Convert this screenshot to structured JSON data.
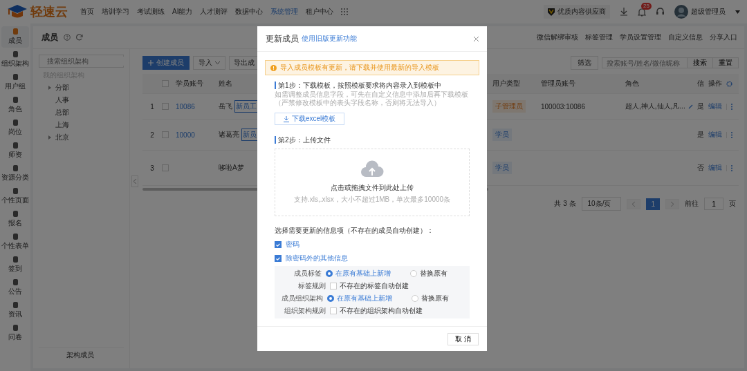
{
  "header": {
    "logo": "轻速云",
    "nav": [
      {
        "label": "首页",
        "selected": false
      },
      {
        "label": "培训学习",
        "selected": false
      },
      {
        "label": "考试测练",
        "selected": false
      },
      {
        "label": "AI能力",
        "selected": false
      },
      {
        "label": "人才测评",
        "selected": false
      },
      {
        "label": "数据中心",
        "selected": false
      },
      {
        "label": "系统管理",
        "selected": true
      },
      {
        "label": "租户中心",
        "selected": false
      }
    ],
    "badge": "优质内容供应商",
    "notifications": "25",
    "user": "超级管理员"
  },
  "sidebar": {
    "items": [
      {
        "label": "成员",
        "selected": true
      },
      {
        "label": "组织架构",
        "selected": false
      },
      {
        "label": "用户组",
        "selected": false
      },
      {
        "label": "角色",
        "selected": false
      },
      {
        "label": "岗位",
        "selected": false
      },
      {
        "label": "师资",
        "selected": false
      },
      {
        "label": "资源分类",
        "selected": false
      },
      {
        "label": "个性页面",
        "selected": false
      },
      {
        "label": "报名",
        "selected": false
      },
      {
        "label": "个性表单",
        "selected": false
      },
      {
        "label": "签到",
        "selected": false
      },
      {
        "label": "公告",
        "selected": false
      },
      {
        "label": "资讯",
        "selected": false
      },
      {
        "label": "问卷",
        "selected": false
      }
    ]
  },
  "page": {
    "title": "成员",
    "actions": [
      "微信解绑审核",
      "标签管理",
      "学员设置管理",
      "自定义信息",
      "分享入口"
    ]
  },
  "tree": {
    "search_placeholder": "搜索组织架构",
    "root": "我的组织架构",
    "items": [
      {
        "label": "分部",
        "expandable": true
      },
      {
        "label": "人事",
        "expandable": false
      },
      {
        "label": "总部",
        "expandable": false
      },
      {
        "label": "上海",
        "expandable": false
      },
      {
        "label": "北京",
        "expandable": true
      }
    ],
    "footer": "架构成员"
  },
  "toolbar": {
    "create": "创建成员",
    "import": "导入",
    "export": "导出成",
    "filter": "筛选",
    "search_placeholder": "搜索账号/姓名/微信昵称",
    "search": "搜索",
    "reset": "重置"
  },
  "table": {
    "columns": [
      "学员账号",
      "姓名",
      "用户类型",
      "管理员账号",
      "角色",
      "信",
      "操作"
    ],
    "select_all_checked": false,
    "rows": [
      {
        "index": "1",
        "checked": false,
        "account": "10086",
        "name": "岳飞",
        "tag": "新员工",
        "user_type": "子管理员",
        "kind": "admin",
        "admin_account": "100003:10086",
        "roles": "超人,神人,仙人,凡...",
        "info": "是",
        "action": "编辑"
      },
      {
        "index": "2",
        "checked": false,
        "account": "10000",
        "name": "诸葛亮",
        "tag": "新员",
        "user_type": "学员",
        "kind": "student",
        "admin_account": "",
        "roles": "",
        "info": "是",
        "action": "编辑"
      },
      {
        "index": "3",
        "checked": false,
        "account": "",
        "name": "哆啦A梦",
        "tag": "",
        "user_type": "学员",
        "kind": "student",
        "admin_account": "",
        "roles": "",
        "info": "否",
        "action": "编辑"
      }
    ]
  },
  "pagination": {
    "total": "共 3 条",
    "page_size": "10条/页",
    "pages": [
      {
        "label": "1",
        "selected": true
      }
    ],
    "goto": "前往",
    "goto_value": "1",
    "unit": "页"
  },
  "dialog": {
    "title": "更新成员",
    "title_link": "使用旧版更新功能",
    "alert": "导入成员模板有更新，请下载并使用最新的导入模板",
    "step1": "第1步：下载模板，按照模板要求将内容录入到模板中",
    "step1_note": "如需调整成员信息字段，可先在自定义信息中添加后再下载模板（严禁修改模板中的表头字段名称，否则将无法导入）",
    "download": "下载excel模板",
    "step2": "第2步：上传文件",
    "upload_text": "点击或拖拽文件到此处上传",
    "upload_hint": "支持.xls,.xlsx，大小不超过1MB，单次最多10000条",
    "options_title": "选择需要更新的信息项（不存在的成员自动创建）：",
    "options": [
      {
        "label": "密码",
        "checked": true
      },
      {
        "label": "除密码外的其他信息",
        "checked": true
      }
    ],
    "settings": [
      {
        "label": "成员标签",
        "kind": "radio",
        "choices": [
          {
            "label": "在原有基础上新增",
            "selected": true
          },
          {
            "label": "替换原有",
            "selected": false
          }
        ]
      },
      {
        "label": "标签规则",
        "kind": "checkbox",
        "choices": [
          {
            "label": "不存在的标签自动创建",
            "selected": false
          }
        ]
      },
      {
        "label": "成员组织架构",
        "kind": "radio",
        "choices": [
          {
            "label": "在原有基础上新增",
            "selected": true
          },
          {
            "label": "替换原有",
            "selected": false
          }
        ]
      },
      {
        "label": "组织架构规则",
        "kind": "checkbox",
        "choices": [
          {
            "label": "不存在的组织架构自动创建",
            "selected": false
          }
        ]
      }
    ],
    "cancel": "取 消"
  }
}
